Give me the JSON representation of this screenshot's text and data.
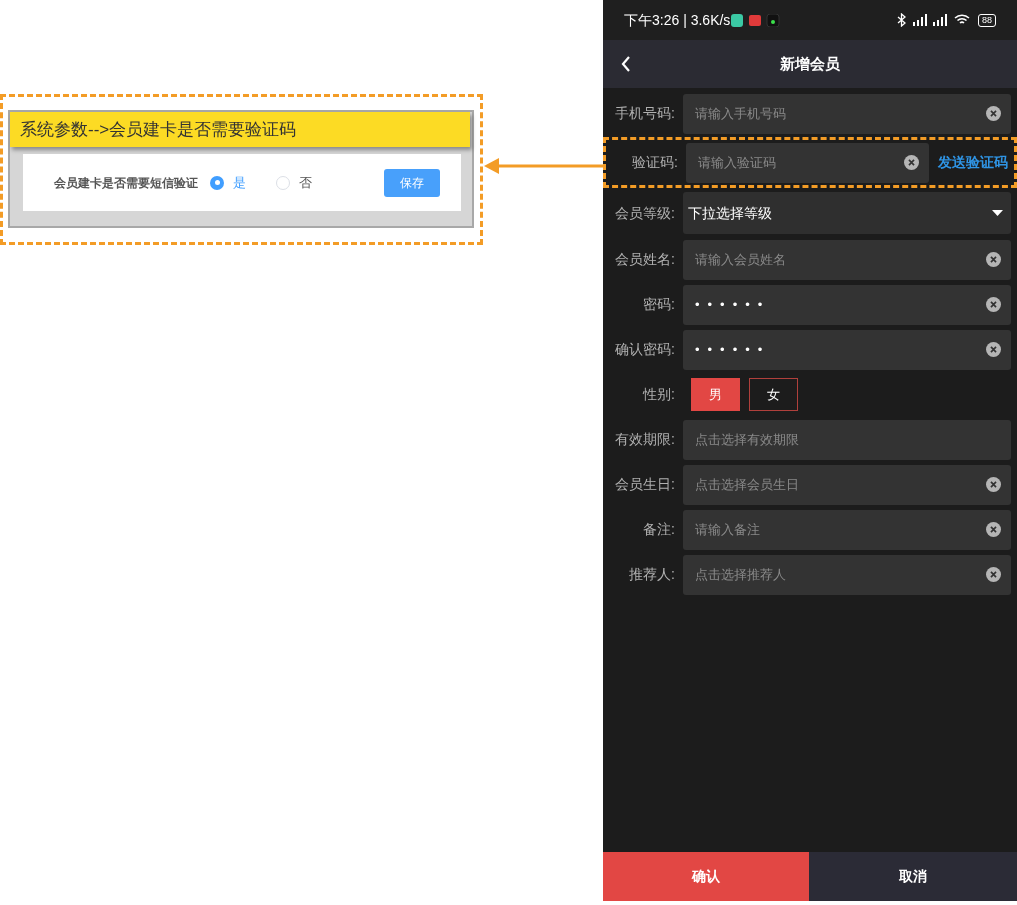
{
  "setting_panel": {
    "title": "系统参数-->会员建卡是否需要验证码",
    "label": "会员建卡是否需要短信验证",
    "options": [
      {
        "label": "是",
        "selected": true
      },
      {
        "label": "否",
        "selected": false
      }
    ],
    "save_button": "保存"
  },
  "status_bar": {
    "time": "下午3:26 | 3.6K/s",
    "battery": "88"
  },
  "header": {
    "title": "新增会员"
  },
  "form": [
    {
      "kind": "text",
      "label": "手机号码:",
      "placeholder": "请输入手机号码",
      "clearable": true,
      "highlighted": false
    },
    {
      "kind": "code",
      "label": "验证码:",
      "placeholder": "请输入验证码",
      "clearable": true,
      "highlighted": true,
      "action": "发送验证码"
    },
    {
      "kind": "select",
      "label": "会员等级:",
      "value": "下拉选择等级"
    },
    {
      "kind": "text",
      "label": "会员姓名:",
      "placeholder": "请输入会员姓名",
      "clearable": true,
      "highlighted": false
    },
    {
      "kind": "password",
      "label": "密码:",
      "value": "••••••",
      "clearable": true,
      "highlighted": false
    },
    {
      "kind": "password",
      "label": "确认密码:",
      "value": "••••••",
      "clearable": true,
      "highlighted": false
    },
    {
      "kind": "gender",
      "label": "性别:",
      "options": [
        {
          "label": "男",
          "selected": true
        },
        {
          "label": "女",
          "selected": false
        }
      ]
    },
    {
      "kind": "text",
      "label": "有效期限:",
      "placeholder": "点击选择有效期限",
      "clearable": false,
      "highlighted": false
    },
    {
      "kind": "text",
      "label": "会员生日:",
      "placeholder": "点击选择会员生日",
      "clearable": true,
      "highlighted": false
    },
    {
      "kind": "text",
      "label": "备注:",
      "placeholder": "请输入备注",
      "clearable": true,
      "highlighted": false
    },
    {
      "kind": "text",
      "label": "推荐人:",
      "placeholder": "点击选择推荐人",
      "clearable": true,
      "highlighted": false
    }
  ],
  "footer": {
    "confirm": "确认",
    "cancel": "取消"
  }
}
